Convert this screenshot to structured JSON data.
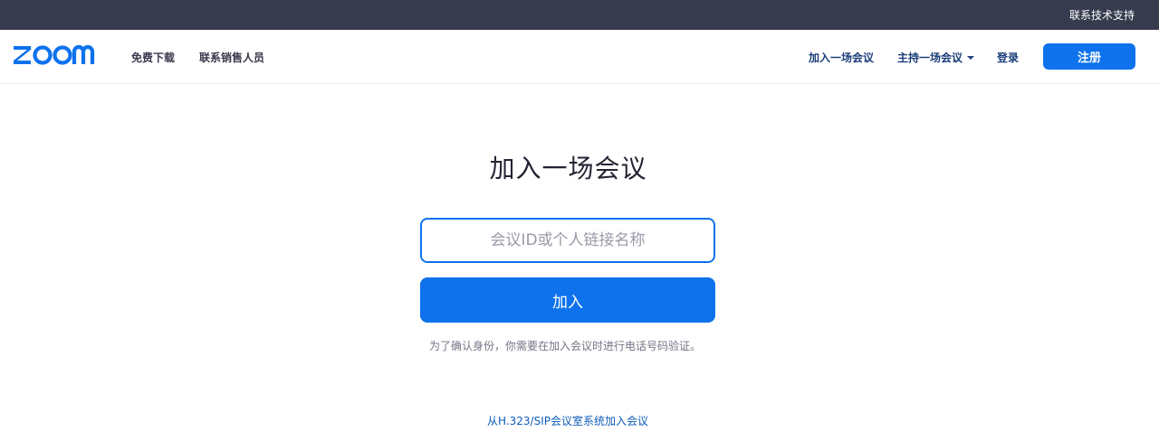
{
  "topbar": {
    "support_label": "联系技术支持"
  },
  "brand": {
    "logo_text": "zoom",
    "accent": "#0e72ed",
    "topbar_bg": "#363b4e"
  },
  "nav": {
    "left": [
      {
        "label": "免费下载"
      },
      {
        "label": "联系销售人员"
      }
    ],
    "right": [
      {
        "label": "加入一场会议"
      },
      {
        "label": "主持一场会议"
      },
      {
        "label": "登录"
      }
    ],
    "signup_label": "注册",
    "host_dropdown_icon": "caret-down-icon"
  },
  "main": {
    "title": "加入一场会议",
    "meeting_input": {
      "placeholder": "会议ID或个人链接名称",
      "value": ""
    },
    "join_label": "加入",
    "notice": "为了确认身份，你需要在加入会议时进行电话号码验证。",
    "sip_link": "从H.323/SIP会议室系统加入会议"
  }
}
